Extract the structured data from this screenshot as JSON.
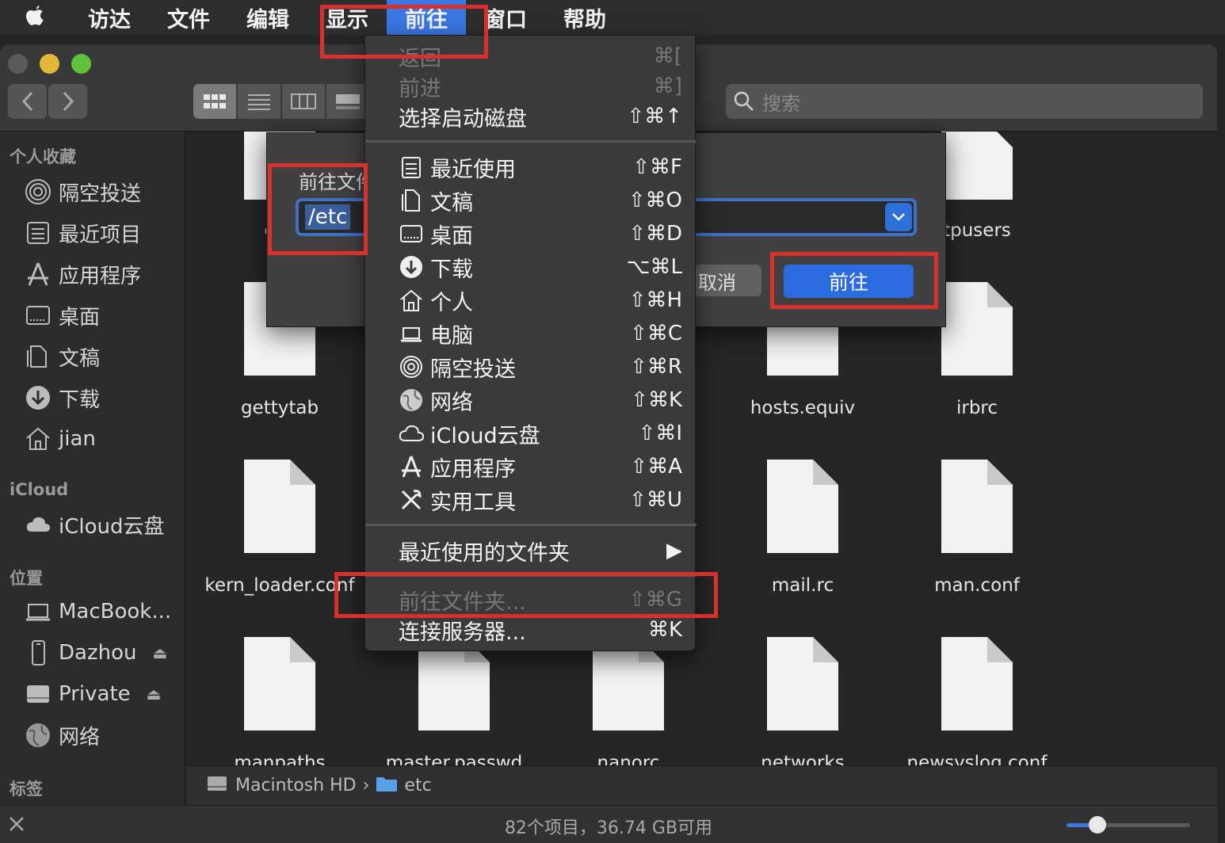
{
  "menubar": {
    "items": [
      {
        "label": "访达"
      },
      {
        "label": "文件"
      },
      {
        "label": "编辑"
      },
      {
        "label": "显示"
      },
      {
        "label": "前往"
      },
      {
        "label": "窗口"
      },
      {
        "label": "帮助"
      }
    ]
  },
  "toolbar": {
    "search_placeholder": "搜索"
  },
  "sidebar": {
    "favorites_header": "个人收藏",
    "favorites": [
      {
        "label": "隔空投送"
      },
      {
        "label": "最近项目"
      },
      {
        "label": "应用程序"
      },
      {
        "label": "桌面"
      },
      {
        "label": "文稿"
      },
      {
        "label": "下载"
      },
      {
        "label": "jian"
      }
    ],
    "icloud_header": "iCloud",
    "icloud": [
      {
        "label": "iCloud云盘"
      }
    ],
    "locations_header": "位置",
    "locations": [
      {
        "label": "MacBook..."
      },
      {
        "label": "Dazhou"
      },
      {
        "label": "Private"
      },
      {
        "label": "网络"
      }
    ],
    "tags_header": "标签"
  },
  "files": {
    "row1": [
      "csh",
      "tpusers"
    ],
    "row2": [
      "gettytab",
      "hosts.equiv",
      "irbrc"
    ],
    "row3": [
      "kern_loader.conf",
      "mail.rc",
      "man.conf"
    ],
    "row4": [
      "manpaths",
      "master.passwd",
      "nanorc",
      "networks",
      "newsyslog.conf"
    ]
  },
  "pathbar": {
    "disk": "Macintosh HD",
    "folder": "etc",
    "separator": "›"
  },
  "statusbar": {
    "text": "82个项目，36.74 GB可用",
    "icon_size_fraction": 0.25
  },
  "goto_sheet": {
    "title": "前往文件夹:",
    "input_value": "/etc",
    "cancel_label": "取消",
    "go_label": "前往"
  },
  "go_menu": {
    "back": {
      "label": "返回",
      "shortcut": "⌘["
    },
    "forward": {
      "label": "前进",
      "shortcut": "⌘]"
    },
    "startup_disk": {
      "label": "选择启动磁盘",
      "shortcut": "⇧⌘↑"
    },
    "recents": {
      "label": "最近使用",
      "shortcut": "⇧⌘F"
    },
    "documents": {
      "label": "文稿",
      "shortcut": "⇧⌘O"
    },
    "desktop": {
      "label": "桌面",
      "shortcut": "⇧⌘D"
    },
    "downloads": {
      "label": "下载",
      "shortcut": "⌥⌘L"
    },
    "home": {
      "label": "个人",
      "shortcut": "⇧⌘H"
    },
    "computer": {
      "label": "电脑",
      "shortcut": "⇧⌘C"
    },
    "airdrop": {
      "label": "隔空投送",
      "shortcut": "⇧⌘R"
    },
    "network": {
      "label": "网络",
      "shortcut": "⇧⌘K"
    },
    "icloud": {
      "label": "iCloud云盘",
      "shortcut": "⇧⌘I"
    },
    "applications": {
      "label": "应用程序",
      "shortcut": "⇧⌘A"
    },
    "utilities": {
      "label": "实用工具",
      "shortcut": "⇧⌘U"
    },
    "recent_folders": {
      "label": "最近使用的文件夹",
      "shortcut": "▶"
    },
    "goto_folder": {
      "label": "前往文件夹...",
      "shortcut": "⇧⌘G"
    },
    "connect_server": {
      "label": "连接服务器...",
      "shortcut": "⌘K"
    }
  },
  "colors": {
    "accent": "#3a77e2",
    "highlight_red": "#d9302c"
  }
}
